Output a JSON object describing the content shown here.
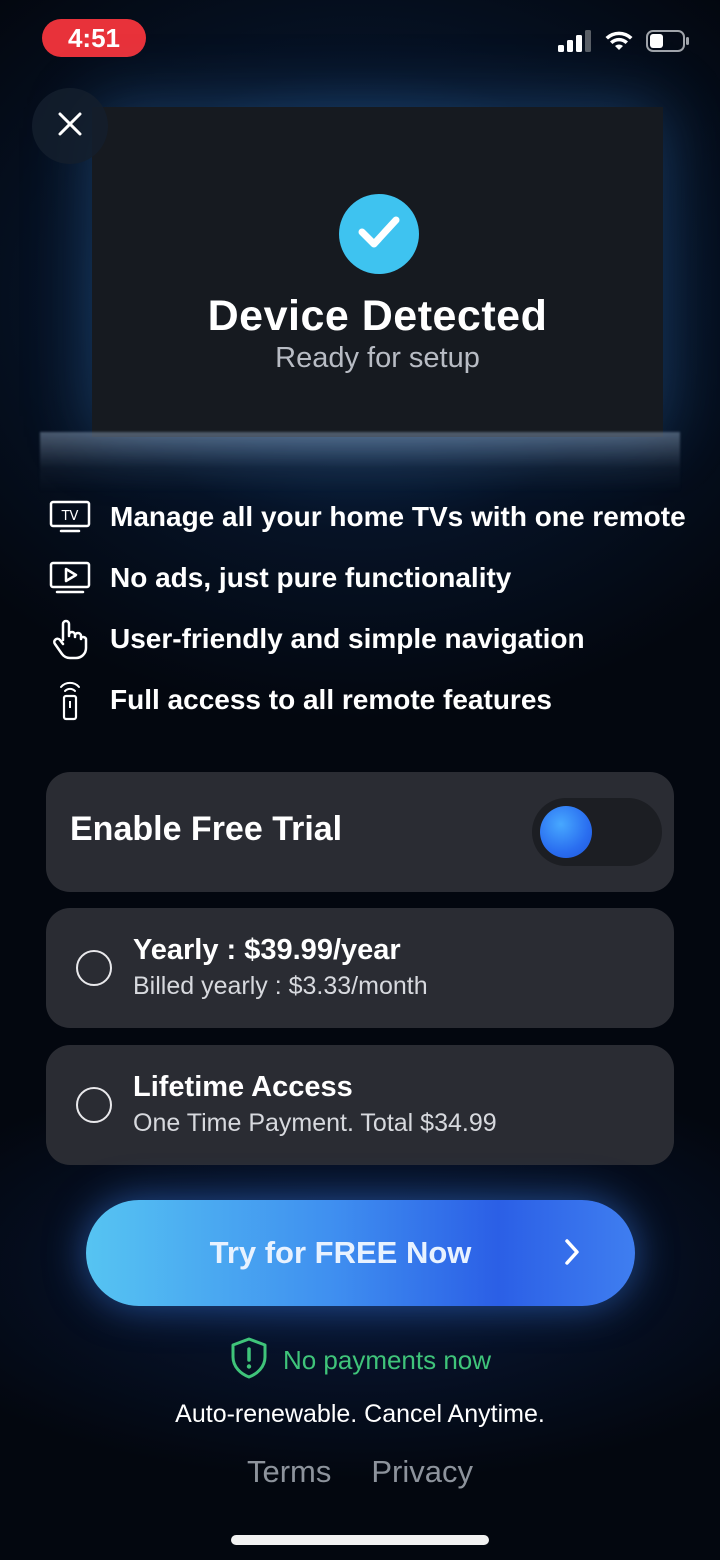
{
  "status_bar": {
    "time": "4:51",
    "icons": [
      "signal-icon",
      "wifi-icon",
      "battery-icon"
    ]
  },
  "close_icon": "close-icon",
  "device": {
    "title": "Device Detected",
    "subtitle": "Ready for setup",
    "check_icon": "check-icon"
  },
  "features": [
    {
      "icon": "tv-icon",
      "label": "Manage all your home TVs with one remote"
    },
    {
      "icon": "play-screen-icon",
      "label": "No ads, just pure functionality"
    },
    {
      "icon": "hand-pointer-icon",
      "label": "User-friendly and simple navigation"
    },
    {
      "icon": "remote-icon",
      "label": "Full access to all remote features"
    }
  ],
  "trial": {
    "label": "Enable Free Trial",
    "enabled": true
  },
  "plans": [
    {
      "title": "Yearly : $39.99/year",
      "subtitle": "Billed yearly : $3.33/month",
      "selected": false
    },
    {
      "title": "Lifetime Access",
      "subtitle": "One Time Payment. Total $34.99",
      "selected": false
    }
  ],
  "cta": {
    "label": "Try for FREE Now",
    "icon": "chevron-right-icon"
  },
  "no_payment": {
    "icon": "shield-alert-icon",
    "text": "No payments now"
  },
  "renew_text": "Auto-renewable. Cancel Anytime.",
  "links": {
    "terms": "Terms",
    "privacy": "Privacy"
  },
  "colors": {
    "accent_blue": "#3ec3f0",
    "toggle_knob": "#2a6ef0",
    "success_green": "#3fc47a",
    "card_bg": "#2a2c33",
    "time_pill": "#e8323a"
  }
}
